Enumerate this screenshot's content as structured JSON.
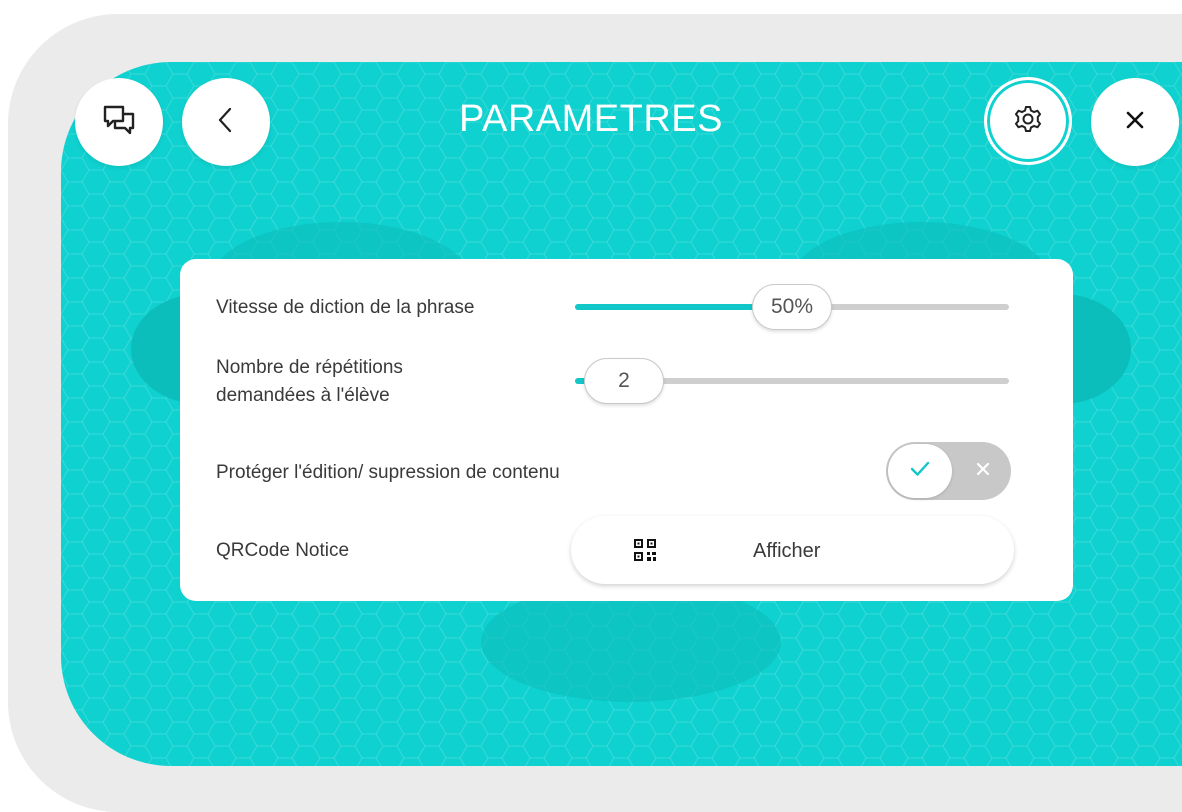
{
  "header": {
    "title": "PARAMETRES",
    "chat_icon": "chat-bubbles-icon",
    "back_icon": "chevron-left-icon",
    "settings_icon": "gear-icon",
    "close_icon": "close-icon"
  },
  "settings": {
    "speed": {
      "label": "Vitesse de diction de la phrase",
      "value_text": "50%",
      "value": 0.5
    },
    "repetitions": {
      "label_line1": "Nombre de répétitions",
      "label_line2": "demandées à l'élève",
      "value_text": "2",
      "value": 0.0
    },
    "protect": {
      "label": "Protéger l'édition/ supression de contenu",
      "enabled": true
    },
    "qrcode": {
      "label": "QRCode Notice",
      "button_label": "Afficher",
      "icon": "qrcode-icon"
    }
  },
  "colors": {
    "accent": "#0fd1cf",
    "slider_fill": "#12c7c8",
    "frame": "#ebebeb",
    "panel": "#ffffff"
  }
}
